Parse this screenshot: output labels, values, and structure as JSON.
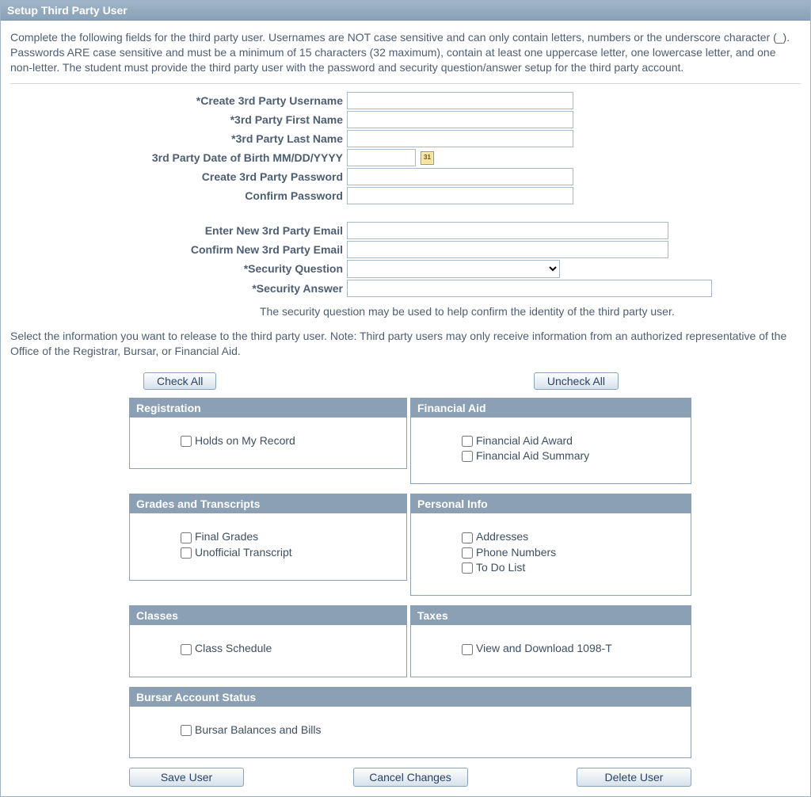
{
  "title": "Setup Third Party User",
  "instructions": "Complete the following fields for the third party user.  Usernames are NOT case sensitive and can only contain letters, numbers or the underscore character (_).  Passwords ARE case sensitive and must be a minimum of 15 characters (32 maximum), contain at least one uppercase letter, one lowercase letter, and one non-letter.  The student must provide the third party user with the password and security question/answer setup for the third party account.",
  "fields": {
    "username_label": "*Create 3rd Party Username",
    "firstname_label": "*3rd Party First Name",
    "lastname_label": "*3rd Party Last Name",
    "dob_label": "3rd Party Date of Birth MM/DD/YYYY",
    "password_label": "Create 3rd Party Password",
    "confirm_password_label": "Confirm Password",
    "email_label": "Enter New 3rd Party Email",
    "confirm_email_label": "Confirm New 3rd Party Email",
    "secq_label": "*Security Question",
    "seca_label": "*Security Answer"
  },
  "security_hint": "The security question may be used to help confirm the identity of the third party user.",
  "select_instructions": "Select the information you want to release to the third party user. Note: Third party users may only receive information from an authorized representative of the Office of the Registrar, Bursar, or Financial Aid.",
  "buttons": {
    "check_all": "Check All",
    "uncheck_all": "Uncheck All",
    "save": "Save User",
    "cancel": "Cancel Changes",
    "delete": "Delete User"
  },
  "panels": {
    "registration": {
      "title": "Registration",
      "items": [
        "Holds on My Record"
      ]
    },
    "financial_aid": {
      "title": "Financial Aid",
      "items": [
        "Financial Aid Award",
        "Financial Aid Summary"
      ]
    },
    "grades": {
      "title": "Grades and Transcripts",
      "items": [
        "Final Grades",
        "Unofficial Transcript"
      ]
    },
    "personal": {
      "title": "Personal Info",
      "items": [
        "Addresses",
        "Phone Numbers",
        "To Do List"
      ]
    },
    "classes": {
      "title": "Classes",
      "items": [
        "Class Schedule"
      ]
    },
    "taxes": {
      "title": "Taxes",
      "items": [
        "View and Download 1098-T"
      ]
    },
    "bursar": {
      "title": "Bursar Account Status",
      "items": [
        "Bursar Balances and Bills"
      ]
    }
  },
  "cal_icon_text": "31"
}
